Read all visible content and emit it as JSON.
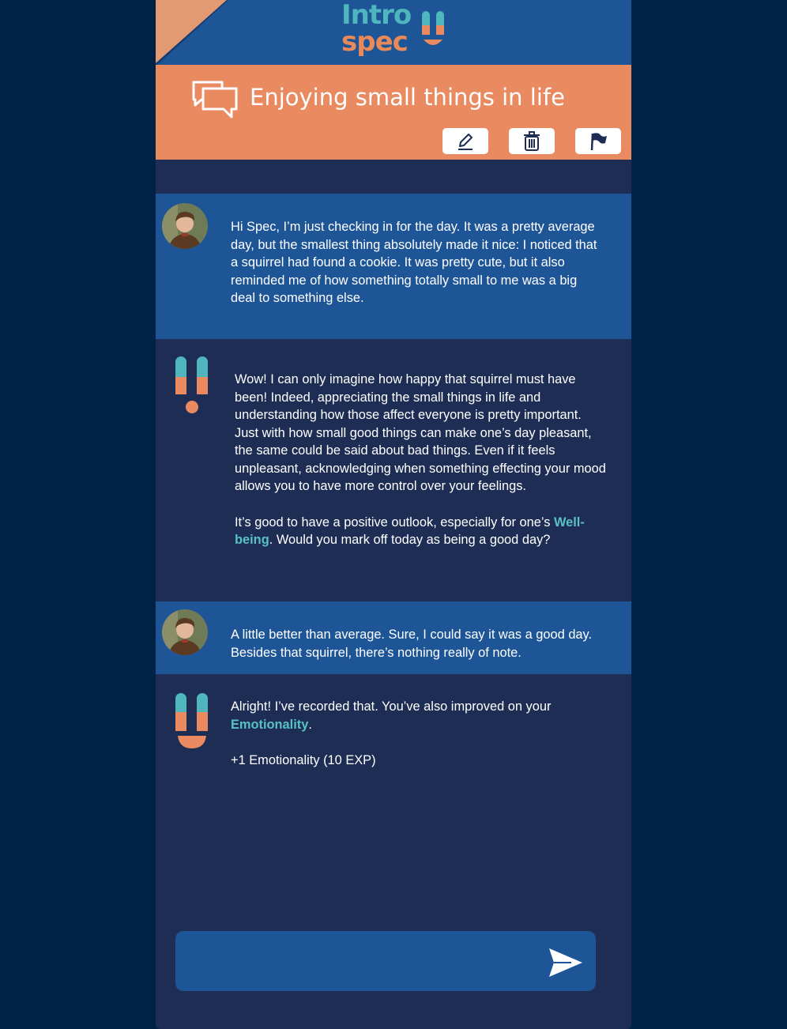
{
  "header": {
    "logo_line1": "Intro",
    "logo_line2": "spec",
    "colors": {
      "bar": "#1d5597",
      "accent": "#e98a60",
      "teal": "#4fb6bd"
    }
  },
  "topic": {
    "title": "Enjoying small things in life",
    "icon": "chat-bubbles-icon",
    "actions": [
      {
        "name": "edit",
        "icon": "pencil-icon"
      },
      {
        "name": "delete",
        "icon": "trash-icon"
      },
      {
        "name": "report",
        "icon": "flag-icon"
      }
    ]
  },
  "messages": [
    {
      "sender": "user",
      "paragraphs": [
        "Hi Spec, I’m just checking in for the day. It was a pretty average day, but the smallest thing absolutely made it nice: I noticed that a squirrel had found a cookie. It was pretty cute, but it also reminded me of how something totally small to me was a big deal to something else."
      ]
    },
    {
      "sender": "bot",
      "p1": "Wow! I can only imagine how happy that squirrel must have been! Indeed, appreciating the small things in life and understanding how those affect everyone is pretty important. Just with how small good things can make one’s day pleasant, the same could be said about bad things. Even if it feels unpleasant, acknowledging when something effecting your mood allows you to have more control over your feelings.",
      "p2_before": "It’s good to have a positive outlook, especially for one’s ",
      "p2_link": "Well-being",
      "p2_after": ". Would you mark off today as being a good day?"
    },
    {
      "sender": "user",
      "paragraphs": [
        "A little better than average. Sure, I could say it was a good day. Besides that squirrel,  there’s nothing really of note."
      ]
    },
    {
      "sender": "bot",
      "p1_before": "Alright! I’ve recorded that. You’ve also improved on your ",
      "p1_link": "Emotionality",
      "p1_after": ".",
      "p2": "+1 Emotionality (10 EXP)"
    }
  ],
  "composer": {
    "placeholder": "",
    "value": "",
    "send_icon": "send-icon"
  }
}
